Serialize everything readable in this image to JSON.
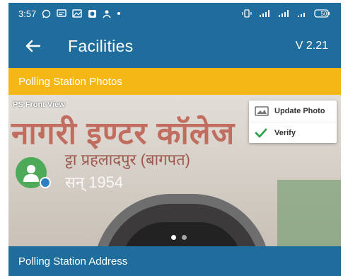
{
  "status_bar": {
    "time": "3:57",
    "battery": "50"
  },
  "app_bar": {
    "title": "Facilities",
    "version": "V 2.21"
  },
  "section": {
    "photos_title": "Polling Station Photos",
    "address_title": "Polling Station Address"
  },
  "photo": {
    "label": "PS Front View",
    "sign_line1": "नागरी इण्टर कॉलेज",
    "sign_line2": "ट्टा प्रहलादपुर (बागपत)",
    "sign_line3": "सन्  1954",
    "carousel_total": 2,
    "carousel_active": 1
  },
  "menu": {
    "update_photo": "Update Photo",
    "verify": "Verify"
  },
  "colors": {
    "primary": "#1f6d9d",
    "accent": "#f5b716",
    "verify_green": "#2fa24b",
    "avatar_green": "#4daa58"
  }
}
